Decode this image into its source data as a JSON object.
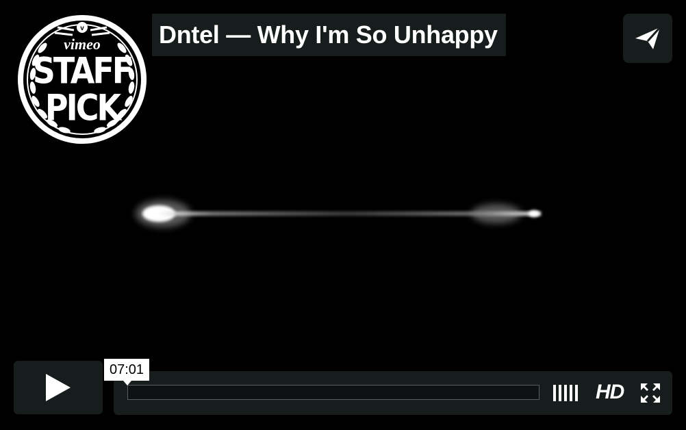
{
  "badge": {
    "brand": "vimeo",
    "line1": "STAFF",
    "line2": "PICK"
  },
  "video": {
    "title": "Dntel — Why I'm So Unhappy"
  },
  "controls": {
    "time_tooltip": "07:01",
    "hd_label": "HD",
    "progress_fraction": 0.0,
    "volume_bars": 5
  },
  "icons": {
    "share": "paper-plane-icon",
    "play": "play-icon",
    "volume": "volume-bars-icon",
    "fullscreen": "fullscreen-icon"
  },
  "colors": {
    "panel": "#171c1c",
    "text": "#ffffff",
    "background": "#000000"
  }
}
